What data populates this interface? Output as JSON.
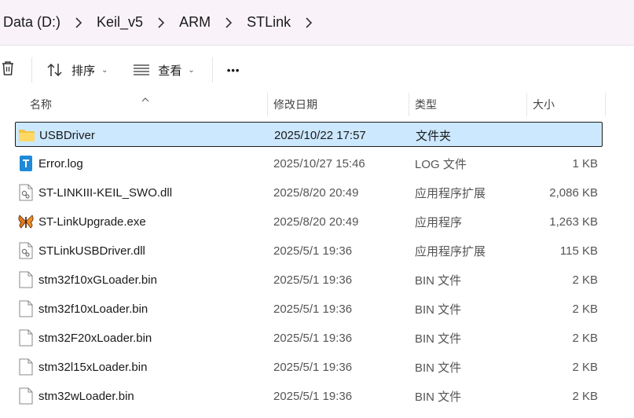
{
  "breadcrumb": {
    "items": [
      "Data (D:)",
      "Keil_v5",
      "ARM",
      "STLink"
    ]
  },
  "toolbar": {
    "sort_label": "排序",
    "view_label": "查看",
    "more_label": "•••"
  },
  "columns": {
    "name": "名称",
    "date": "修改日期",
    "type": "类型",
    "size": "大小"
  },
  "files": [
    {
      "name": "USBDriver",
      "date": "2025/10/22 17:57",
      "type": "文件夹",
      "size": "",
      "icon": "folder-icon",
      "selected": true
    },
    {
      "name": "Error.log",
      "date": "2025/10/27 15:46",
      "type": "LOG 文件",
      "size": "1 KB",
      "icon": "log-file-icon"
    },
    {
      "name": "ST-LINKIII-KEIL_SWO.dll",
      "date": "2025/8/20 20:49",
      "type": "应用程序扩展",
      "size": "2,086 KB",
      "icon": "dll-file-icon"
    },
    {
      "name": "ST-LinkUpgrade.exe",
      "date": "2025/8/20 20:49",
      "type": "应用程序",
      "size": "1,263 KB",
      "icon": "butterfly-app-icon"
    },
    {
      "name": "STLinkUSBDriver.dll",
      "date": "2025/5/1 19:36",
      "type": "应用程序扩展",
      "size": "115 KB",
      "icon": "dll-file-icon"
    },
    {
      "name": "stm32f10xGLoader.bin",
      "date": "2025/5/1 19:36",
      "type": "BIN 文件",
      "size": "2 KB",
      "icon": "blank-file-icon"
    },
    {
      "name": "stm32f10xLoader.bin",
      "date": "2025/5/1 19:36",
      "type": "BIN 文件",
      "size": "2 KB",
      "icon": "blank-file-icon"
    },
    {
      "name": "stm32F20xLoader.bin",
      "date": "2025/5/1 19:36",
      "type": "BIN 文件",
      "size": "2 KB",
      "icon": "blank-file-icon"
    },
    {
      "name": "stm32l15xLoader.bin",
      "date": "2025/5/1 19:36",
      "type": "BIN 文件",
      "size": "2 KB",
      "icon": "blank-file-icon"
    },
    {
      "name": "stm32wLoader.bin",
      "date": "2025/5/1 19:36",
      "type": "BIN 文件",
      "size": "2 KB",
      "icon": "blank-file-icon"
    }
  ],
  "colors": {
    "selection": "#cce8ff",
    "crumbbar_bg": "#f9f3f9",
    "folder": "#f4c542",
    "log_icon": "#1f8ad8"
  }
}
